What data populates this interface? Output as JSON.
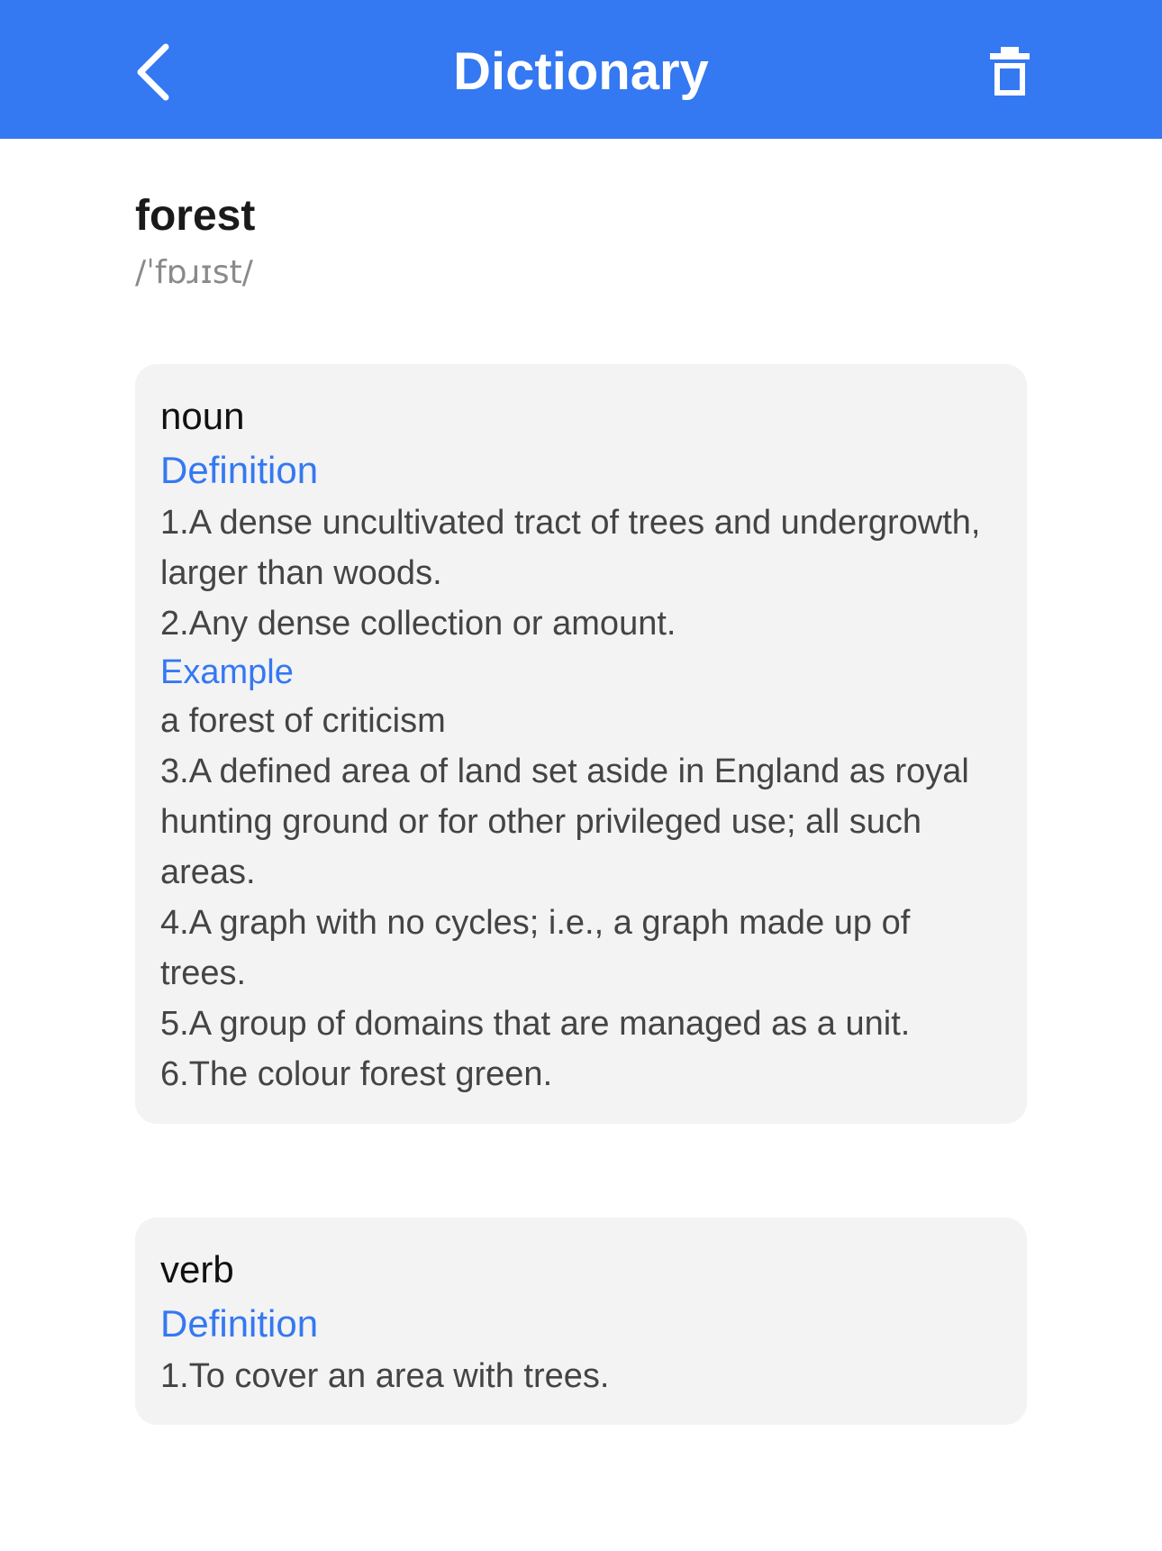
{
  "header": {
    "title": "Dictionary",
    "back_icon": "chevron-left-icon",
    "delete_icon": "trash-icon",
    "color": "#3478F2"
  },
  "entry": {
    "word": "forest",
    "phonetic": "/ˈfɒɹɪst/"
  },
  "noun": {
    "part_of_speech": "noun",
    "definition_label": "Definition",
    "definitions_a": [
      "1.A dense uncultivated tract of trees and undergrowth, larger than woods.",
      "2.Any dense collection or amount."
    ],
    "example_label": "Example",
    "example": "a forest of criticism",
    "definitions_b": [
      "3.A defined area of land set aside in England as royal hunting ground or for other privileged use; all such areas.",
      "4.A graph with no cycles; i.e., a graph made up of trees.",
      "5.A group of domains that are managed as a unit.",
      "6.The colour forest green."
    ]
  },
  "verb": {
    "part_of_speech": "verb",
    "definition_label": "Definition",
    "definitions": [
      "1.To cover an area with trees."
    ]
  }
}
